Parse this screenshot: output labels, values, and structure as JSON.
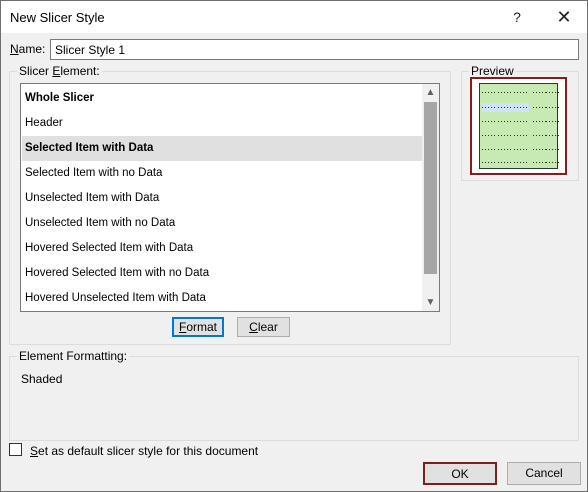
{
  "window": {
    "title": "New Slicer Style",
    "help_glyph": "?",
    "close_glyph": "✕"
  },
  "name": {
    "label_prefix": "",
    "label_underlined": "N",
    "label_suffix": "ame:",
    "value": "Slicer Style 1"
  },
  "slicer_element": {
    "legend_prefix": "Slicer ",
    "legend_underlined": "E",
    "legend_suffix": "lement:",
    "items": [
      {
        "label": "Whole Slicer",
        "bold": true,
        "selected": false
      },
      {
        "label": "Header",
        "bold": false,
        "selected": false
      },
      {
        "label": "Selected Item with Data",
        "bold": true,
        "selected": true
      },
      {
        "label": "Selected Item with no Data",
        "bold": false,
        "selected": false
      },
      {
        "label": "Unselected Item with Data",
        "bold": false,
        "selected": false
      },
      {
        "label": "Unselected Item with no Data",
        "bold": false,
        "selected": false
      },
      {
        "label": "Hovered Selected Item with Data",
        "bold": false,
        "selected": false
      },
      {
        "label": "Hovered Selected Item with no Data",
        "bold": false,
        "selected": false
      },
      {
        "label": "Hovered Unselected Item with Data",
        "bold": false,
        "selected": false
      }
    ],
    "format_button": {
      "underlined": "F",
      "rest": "ormat"
    },
    "clear_button": {
      "underlined": "C",
      "rest": "lear"
    }
  },
  "preview": {
    "legend": "Preview"
  },
  "element_formatting": {
    "legend": "Element Formatting:",
    "value": "Shaded"
  },
  "default_checkbox": {
    "checked": false,
    "label_underlined": "S",
    "label_rest": "et as default slicer style for this document"
  },
  "footer": {
    "ok_label": "OK",
    "cancel_label": "Cancel"
  },
  "colors": {
    "preview_fill": "#c6eab2",
    "preview_border": "#8b1a1a",
    "selected_row": "#e0e0e0",
    "ok_border": "#7b1f1f"
  }
}
